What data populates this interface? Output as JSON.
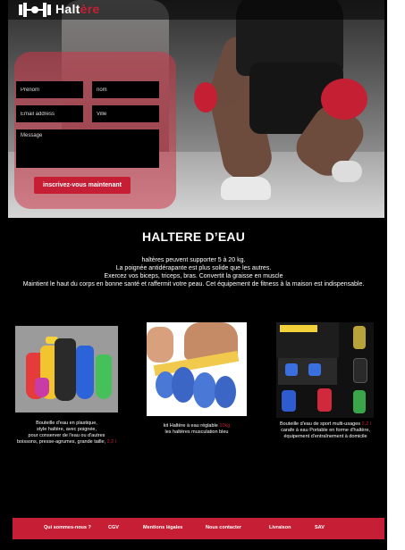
{
  "brand": {
    "name_main": "Halt",
    "name_accent": "ère",
    "accent_color": "#c61f35"
  },
  "form": {
    "prenom_placeholder": "Prénom",
    "nom_placeholder": "nom",
    "email_placeholder": "Email address",
    "ville_placeholder": "Ville",
    "message_placeholder": "Message",
    "submit_label": "inscrivez-vous maintenant"
  },
  "section": {
    "title": "HALTERE D’EAU",
    "lines": [
      "haltères peuvent supporter 5 à 20 kg.",
      "La poignée antidérapante est plus solide que les autres.",
      "Exercez vos biceps, triceps, bras. Convertit la graisse en muscle",
      "Maintient le haut du corps en bonne santé et raffermit votre peau. Cet équipement de fitness à la maison est indispensable."
    ]
  },
  "products": [
    {
      "icon": "colored-water-bottles-image",
      "caption_lines": [
        "Bouteille d'eau en plastique,",
        "style haltère, avec poignée,",
        "pour conserver de l'eau ou d'autres"
      ],
      "caption_last": "boissons, presse-agrumes, grande taille, ",
      "price": "2,2 l"
    },
    {
      "icon": "water-dumbbell-image",
      "caption_first": "kit Haltère à eau réglable ",
      "price": "10kg",
      "caption_lines": [
        "les haltères musculation bleu"
      ]
    },
    {
      "icon": "multi-use-bottle-image",
      "caption_first": "Bouteille d'eau de sport multi-usages ",
      "price": "2,2 l",
      "caption_lines": [
        "carafe à eau Portable en forme d'haltère,",
        "équipement d'entraînement à domicile"
      ]
    }
  ],
  "footer": {
    "links": [
      "Qui sommes-nous ?",
      "CGV",
      "Mentions légales",
      "Nous contacter",
      "Livraison",
      "SAV"
    ]
  }
}
